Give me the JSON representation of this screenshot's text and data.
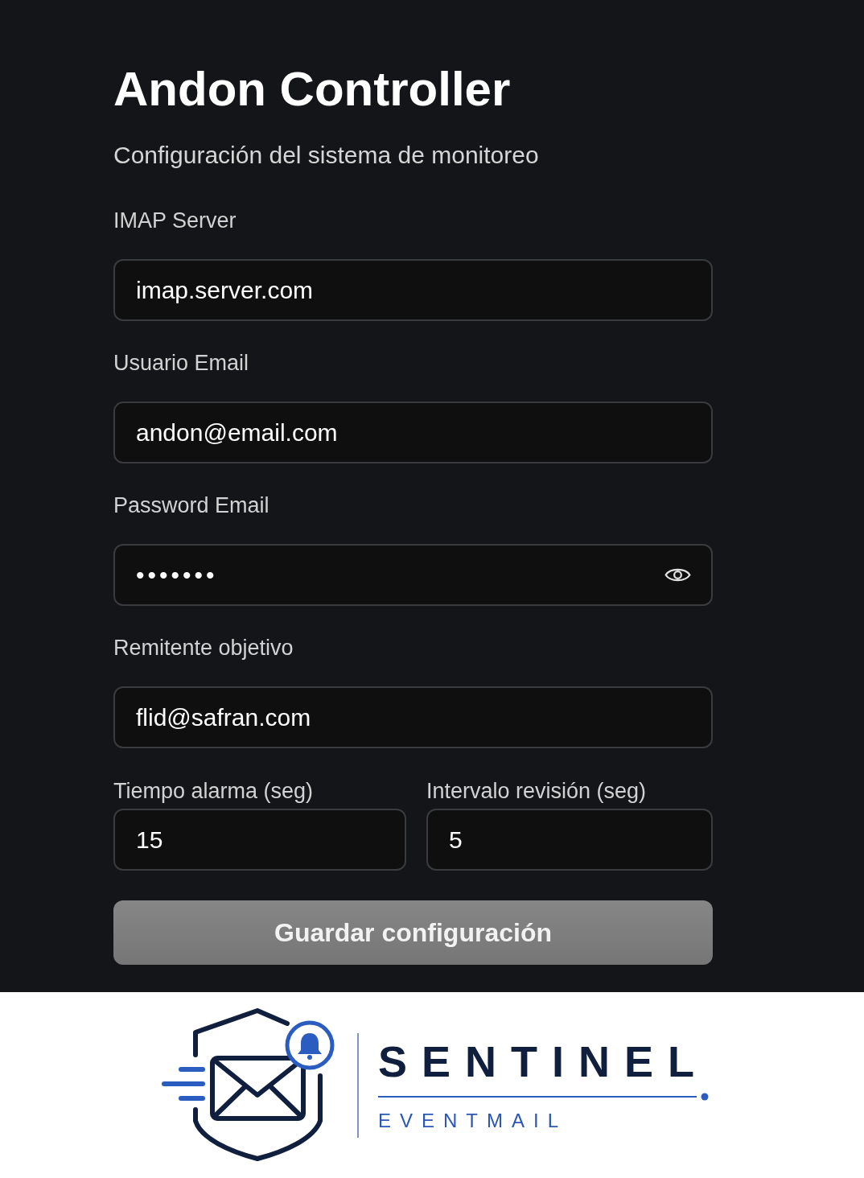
{
  "header": {
    "title": "Andon Controller",
    "subtitle": "Configuración del sistema de monitoreo"
  },
  "fields": [
    {
      "label": "IMAP Server",
      "value": "imap.server.com",
      "kind": "text"
    },
    {
      "label": "Usuario Email",
      "value": "andon@email.com",
      "kind": "text"
    },
    {
      "label": "Password Email",
      "value": "•••••••",
      "kind": "password"
    },
    {
      "label": "Remitente objetivo",
      "value": "flid@safran.com",
      "kind": "text"
    }
  ],
  "timing_fields": [
    {
      "label": "Tiempo alarma (seg)",
      "value": "15"
    },
    {
      "label": "Intervalo revisión (seg)",
      "value": "5"
    }
  ],
  "save_button": {
    "label": "Guardar configuración",
    "disabled": true
  },
  "logo": {
    "wordmark": "SENTINEL",
    "tagline": "EVENTMAIL"
  }
}
